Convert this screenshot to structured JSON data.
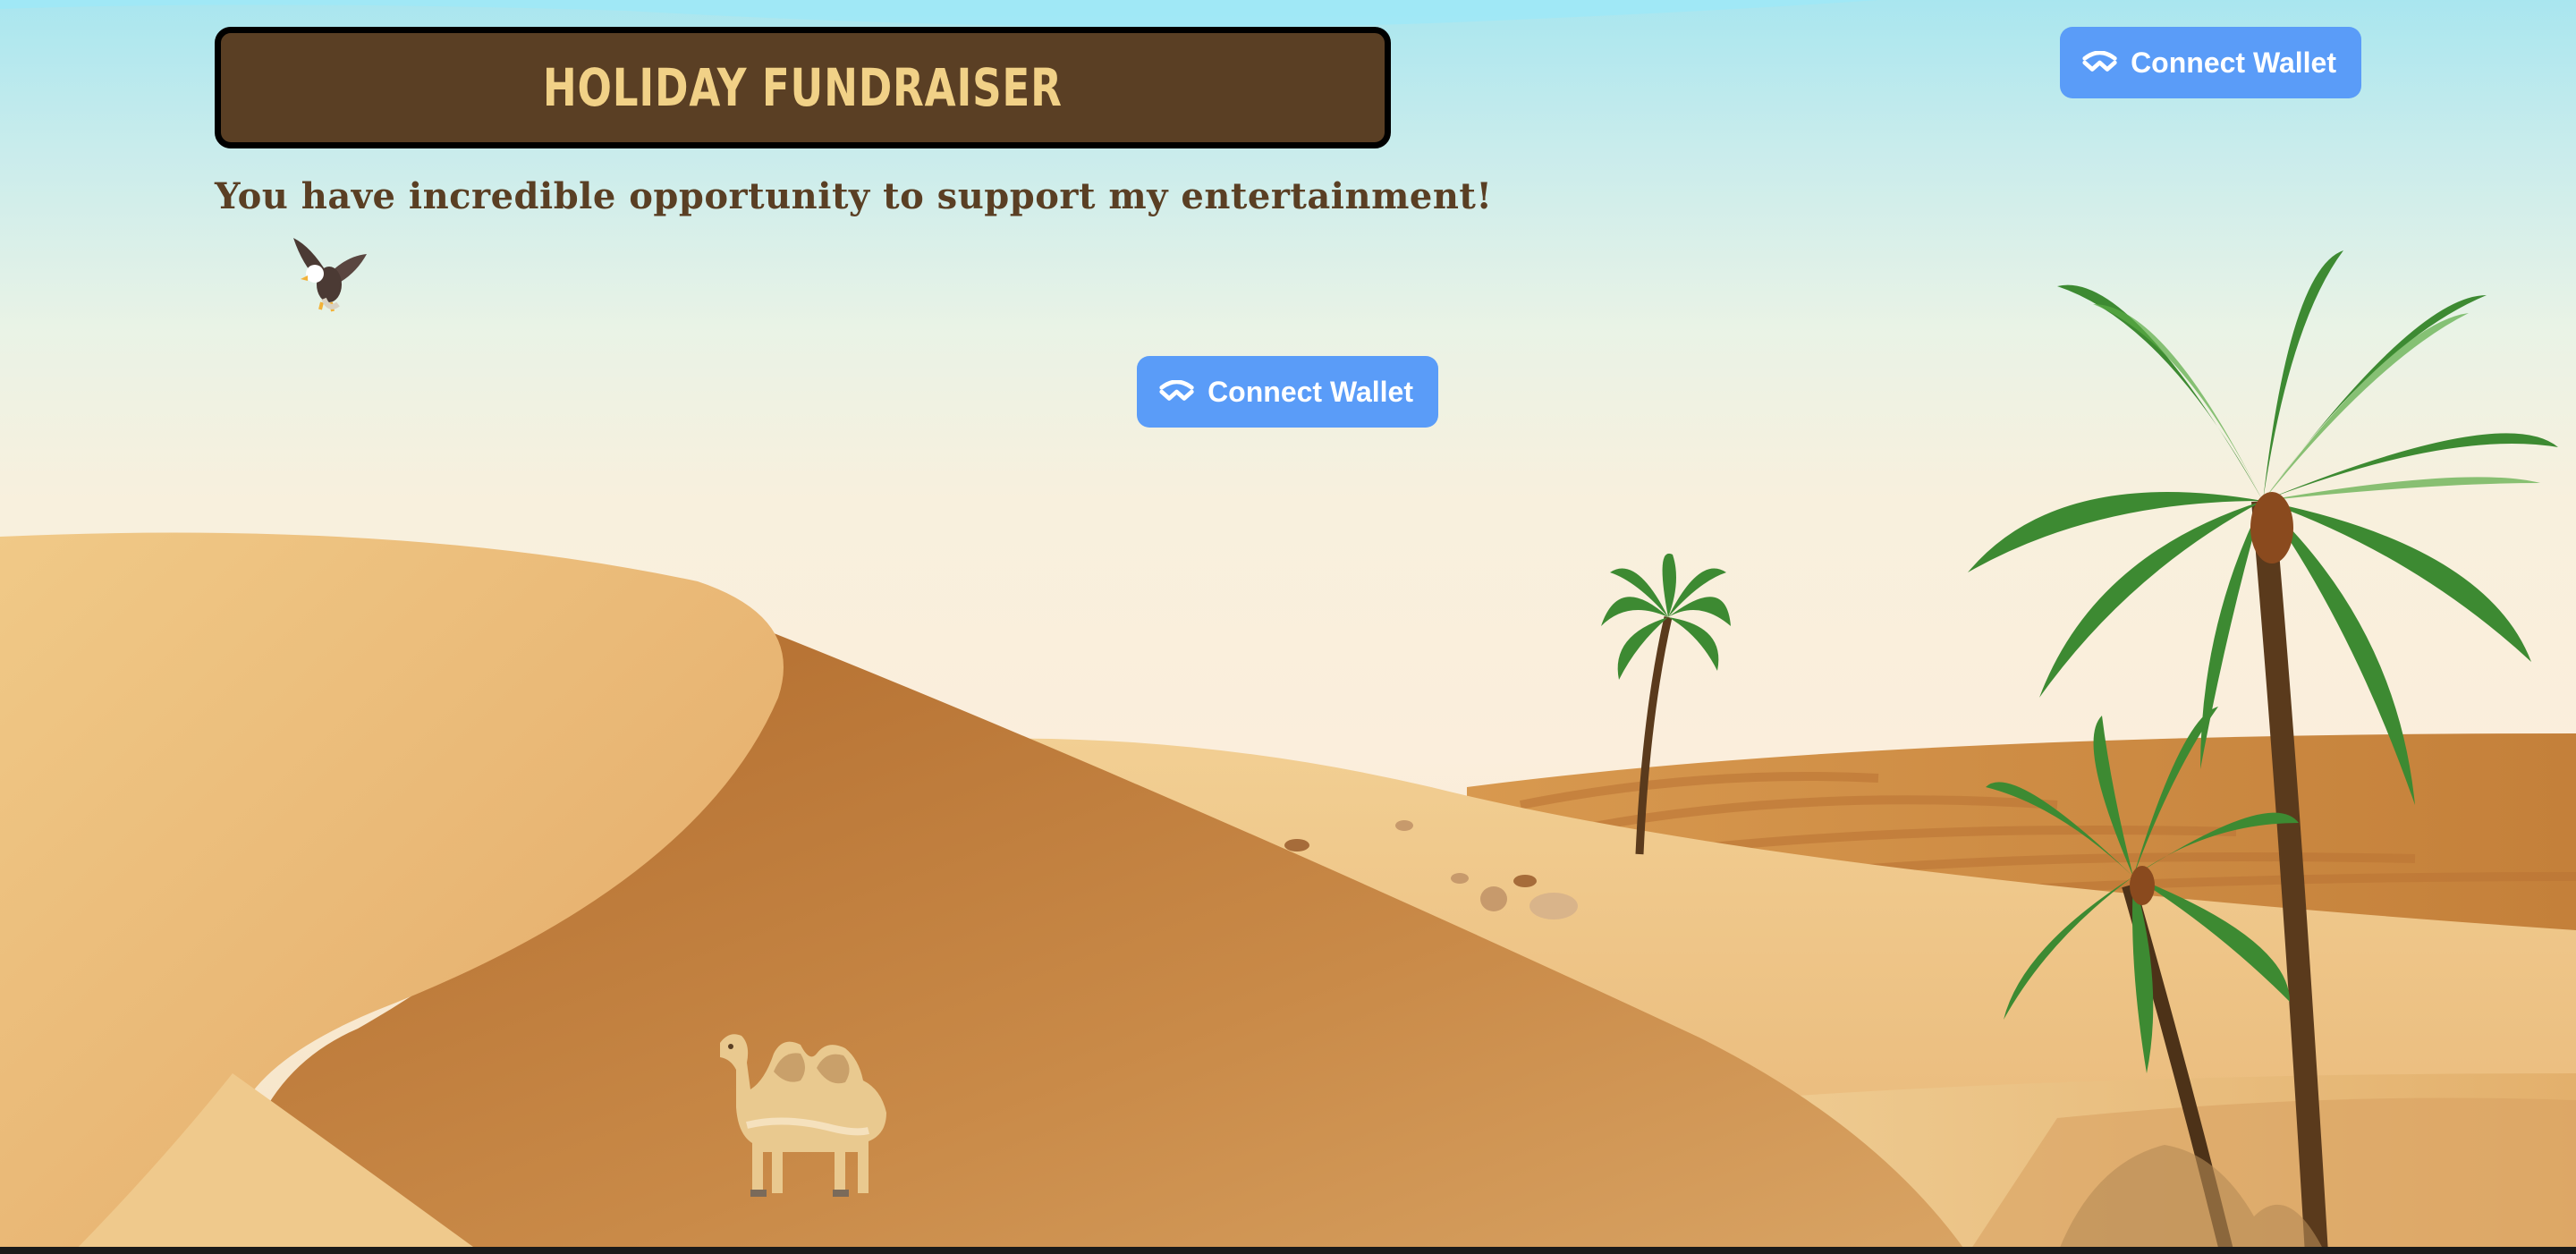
{
  "page": {
    "title": "HOLIDAY FUNDRAISER",
    "subtitle": "You have incredible opportunity to support my entertainment!"
  },
  "header": {
    "connect_wallet_label": "Connect Wallet",
    "wallet_icon": "walletconnect-icon"
  },
  "main": {
    "connect_wallet_label": "Connect Wallet",
    "wallet_icon": "walletconnect-icon"
  },
  "scene": {
    "illustrations": [
      "eagle-icon",
      "camel-icon",
      "palm-tree-icon",
      "desert-dunes"
    ]
  },
  "colors": {
    "title_bg": "#5a3f24",
    "title_text": "#f1d187",
    "button_bg": "#5a9cf8",
    "sand": "#e0a865",
    "sky": "#a9e6ef"
  }
}
